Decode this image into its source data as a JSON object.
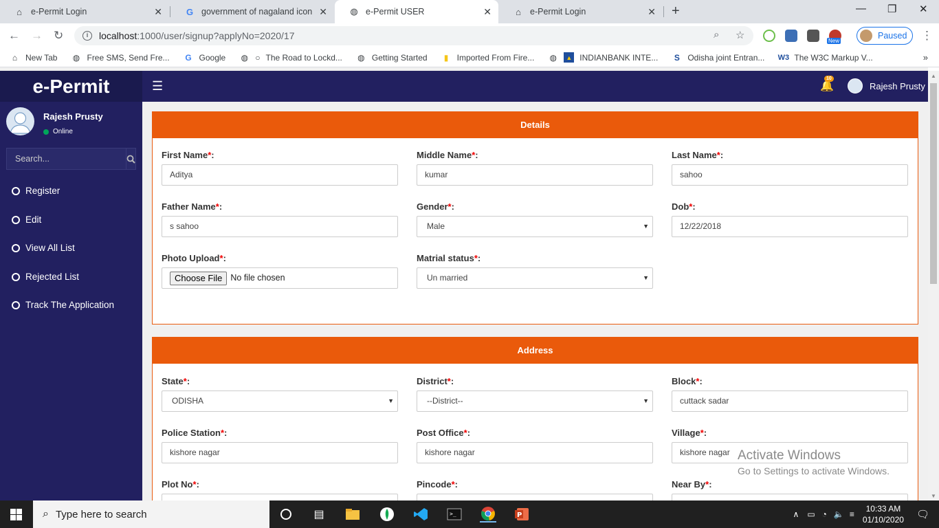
{
  "browser": {
    "tabs": [
      {
        "title": "e-Permit Login",
        "icon": "home-icon"
      },
      {
        "title": "government of nagaland icon - G",
        "icon": "google-icon"
      },
      {
        "title": "e-Permit USER",
        "icon": "globe-icon"
      },
      {
        "title": "e-Permit Login",
        "icon": "home-icon"
      }
    ],
    "url_host": "localhost",
    "url_rest": ":1000/user/signup?applyNo=2020/17",
    "profile_status": "Paused",
    "bookmarks": [
      "New Tab",
      "Free SMS, Send Fre...",
      "Google",
      "The Road to Lockd...",
      "Getting Started",
      "Imported From Fire...",
      "INDIANBANK INTE...",
      "Odisha joint Entran...",
      "The W3C Markup V..."
    ],
    "bookmark_more": "»",
    "extension_badge": "New"
  },
  "app": {
    "brand": "e-Permit",
    "notification_count": "10",
    "user_name": "Rajesh Prusty",
    "user_status": "Online",
    "search_placeholder": "Search...",
    "menu": [
      "Register",
      "Edit",
      "View All List",
      "Rejected List",
      "Track The Application"
    ]
  },
  "details": {
    "title": "Details",
    "first_name": {
      "label": "First Name",
      "value": "Aditya"
    },
    "middle_name": {
      "label": "Middle Name",
      "value": "kumar"
    },
    "last_name": {
      "label": "Last Name",
      "value": "sahoo"
    },
    "father_name": {
      "label": "Father Name",
      "value": "s sahoo"
    },
    "gender": {
      "label": "Gender",
      "value": "Male"
    },
    "dob": {
      "label": "Dob",
      "value": "12/22/2018"
    },
    "photo": {
      "label": "Photo Upload",
      "button": "Choose File",
      "value": "No file chosen"
    },
    "marital": {
      "label": "Matrial status",
      "value": "Un married"
    }
  },
  "address": {
    "title": "Address",
    "state": {
      "label": "State",
      "value": "ODISHA"
    },
    "district": {
      "label": "District",
      "value": "--District--"
    },
    "block": {
      "label": "Block",
      "value": "cuttack sadar"
    },
    "police_station": {
      "label": "Police Station",
      "value": "kishore nagar"
    },
    "post_office": {
      "label": "Post Office",
      "value": "kishore nagar"
    },
    "village": {
      "label": "Village",
      "value": "kishore nagar"
    },
    "plot_no": {
      "label": "Plot No"
    },
    "pincode": {
      "label": "Pincode"
    },
    "near_by": {
      "label": "Near By"
    }
  },
  "required_mark": "*",
  "label_suffix": ":",
  "watermark": {
    "line1": "Activate Windows",
    "line2": "Go to Settings to activate Windows."
  },
  "taskbar": {
    "search_placeholder": "Type here to search",
    "time": "10:33 AM",
    "date": "01/10/2020"
  },
  "colors": {
    "accent": "#ea5a0b",
    "sidebar": "#222060",
    "brand_bg": "#1a1a4e"
  }
}
